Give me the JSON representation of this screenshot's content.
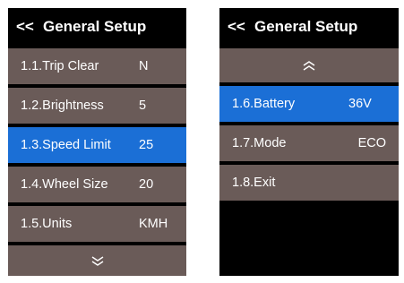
{
  "left_screen": {
    "header": {
      "back": "<<",
      "title": "General Setup"
    },
    "rows": [
      {
        "label": "1.1.Trip Clear",
        "value": "N"
      },
      {
        "label": "1.2.Brightness",
        "value": "5"
      },
      {
        "label": "1.3.Speed Limit",
        "value": "25",
        "selected": true
      },
      {
        "label": "1.4.Wheel Size",
        "value": "20"
      },
      {
        "label": "1.5.Units",
        "value": "KMH"
      }
    ],
    "scroll_icon": "double-chevron-down-icon"
  },
  "right_screen": {
    "header": {
      "back": "<<",
      "title": "General Setup"
    },
    "scroll_icon": "double-chevron-up-icon",
    "rows": [
      {
        "label": "1.6.Battery",
        "value": "36V",
        "selected": true
      },
      {
        "label": "1.7.Mode",
        "value": "ECO"
      },
      {
        "label": "1.8.Exit",
        "value": ""
      }
    ]
  },
  "colors": {
    "row_background": "#6a5b58",
    "selected_background": "#1b6fd6",
    "screen_background": "#000000"
  }
}
